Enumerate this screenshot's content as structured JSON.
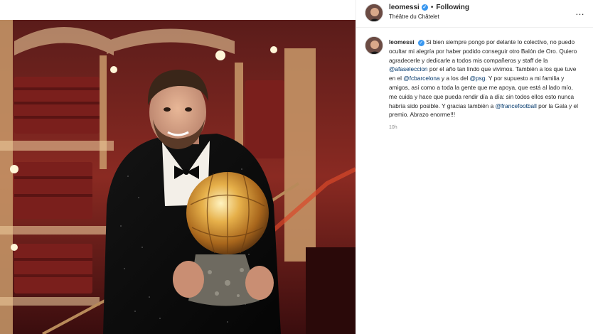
{
  "post": {
    "username": "leomessi",
    "follow_status": "Following",
    "separator": "•",
    "location": "Théâtre du Châtelet",
    "more_icon": "…"
  },
  "caption": {
    "username": "leomessi",
    "segments": [
      {
        "text": "Si bien siempre pongo por delante lo colectivo, no puedo ocultar mi alegría por haber podido conseguir otro Balón de Oro. Quiero agradecerle y dedicarle a todos mis compañeros y staff de la ",
        "mention": false
      },
      {
        "text": "@afaseleccion",
        "mention": true
      },
      {
        "text": " por el año tan lindo que vivimos. También a los que tuve en el ",
        "mention": false
      },
      {
        "text": "@fcbarcelona",
        "mention": true
      },
      {
        "text": " y a los del ",
        "mention": false
      },
      {
        "text": "@psg",
        "mention": true
      },
      {
        "text": ". Y por supuesto a mi familia y amigos, así como a toda la gente que me apoya, que está al lado mío, me cuida y hace que pueda rendir día a día: sin todos ellos esto nunca habría sido posible. Y gracias también a ",
        "mention": false
      },
      {
        "text": "@francefootball",
        "mention": true
      },
      {
        "text": " por la Gala y el premio. Abrazo enorme!!!",
        "mention": false
      }
    ],
    "timestamp": "10h"
  },
  "colors": {
    "verified": "#3897f0",
    "mention": "#00376b",
    "text": "#262626",
    "muted": "#8e8e8e"
  }
}
